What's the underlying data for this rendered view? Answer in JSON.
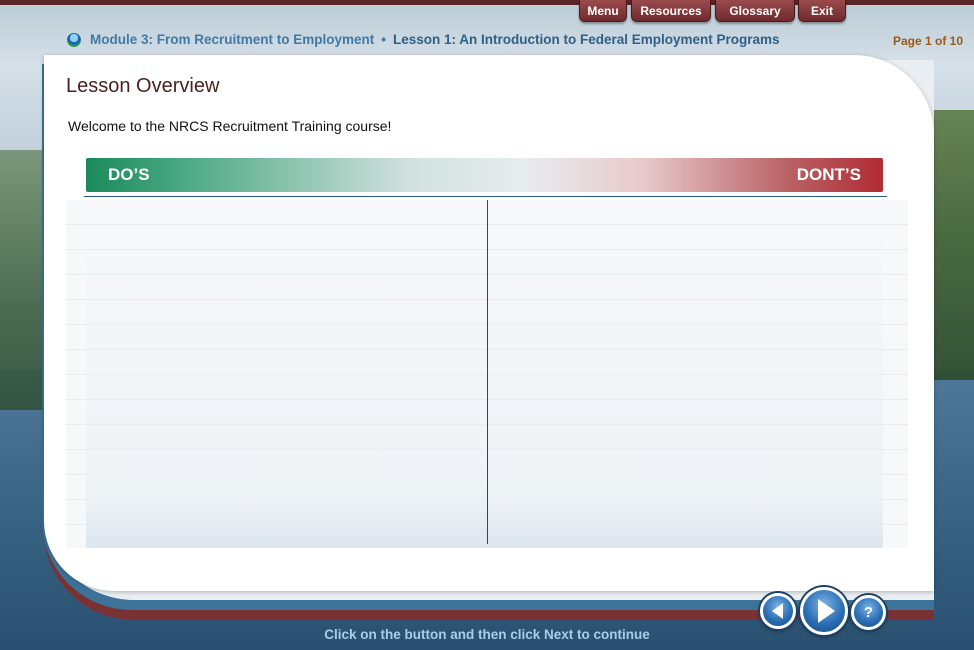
{
  "nav": {
    "menu": "Menu",
    "resources": "Resources",
    "glossary": "Glossary",
    "exit": "Exit"
  },
  "header": {
    "module": "Module 3: From Recruitment to Employment",
    "separator": "•",
    "lesson": "Lesson 1: An Introduction to Federal Employment Programs",
    "page": "Page 1 of 10"
  },
  "content": {
    "title": "Lesson Overview",
    "welcome": "Welcome to the NRCS Recruitment Training course!",
    "dos_label": "DO’S",
    "donts_label": "DONT’S"
  },
  "controls": {
    "back_icon": "back-arrow-icon",
    "next_icon": "next-arrow-icon",
    "help_label": "?"
  },
  "footer": {
    "instruction": "Click on the button and then click Next to continue"
  },
  "colors": {
    "nav_button": "#7a2f32",
    "header_text": "#3f7aa6",
    "page_text": "#9a5a16",
    "dos_green": "#1a8a5a",
    "donts_red": "#b02d33",
    "divider": "#8a2226"
  }
}
